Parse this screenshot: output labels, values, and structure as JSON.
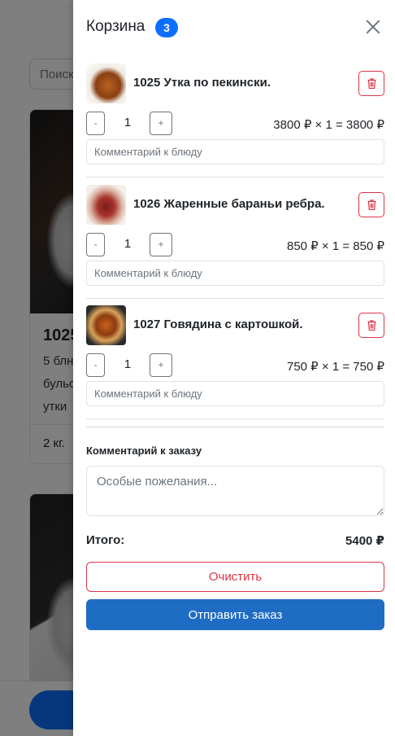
{
  "background": {
    "search_placeholder": "Поиск",
    "card1": {
      "title": "1025",
      "desc_lines": [
        "5 блн",
        "бульо",
        "утки"
      ],
      "footer": "2 кг."
    }
  },
  "cart": {
    "title": "Корзина",
    "badge_count": "3",
    "items": [
      {
        "name": "1025 Утка по пекински.",
        "qty": "1",
        "line_total": "3800 ₽ × 1 = 3800 ₽",
        "comment_placeholder": "Комментарий к блюду",
        "minus_label": "-",
        "plus_label": "+"
      },
      {
        "name": "1026 Жаренные бараньи ребра.",
        "qty": "1",
        "line_total": "850 ₽ × 1 = 850 ₽",
        "comment_placeholder": "Комментарий к блюду",
        "minus_label": "-",
        "plus_label": "+"
      },
      {
        "name": "1027 Говядина с картошкой.",
        "qty": "1",
        "line_total": "750 ₽ × 1 = 750 ₽",
        "comment_placeholder": "Комментарий к блюду",
        "minus_label": "-",
        "plus_label": "+"
      }
    ],
    "order_comment_label": "Комментарий к заказу",
    "order_comment_placeholder": "Особые пожелания...",
    "total_label": "Итого:",
    "total_value": "5400 ₽",
    "clear_label": "Очистить",
    "submit_label": "Отправить заказ"
  },
  "colors": {
    "primary": "#0d6efd",
    "submit": "#1f6cc4",
    "danger": "#dc3545"
  }
}
